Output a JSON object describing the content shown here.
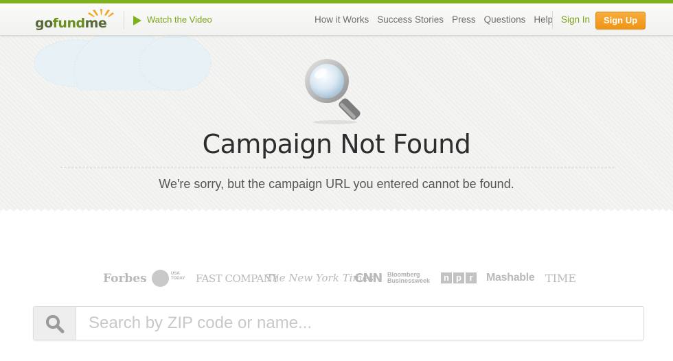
{
  "colors": {
    "accent_green": "#7fb21a",
    "link_green": "#7ba21a",
    "signup_orange": "#f0a028",
    "title_text": "#2d2d2d"
  },
  "header": {
    "logo_alt": "gofundme",
    "logo_go": "go",
    "logo_fund": "fund",
    "logo_me": "me",
    "watch_video_label": "Watch the Video",
    "nav": [
      "How it Works",
      "Success Stories",
      "Press",
      "Questions",
      "Help"
    ],
    "signin_label": "Sign In",
    "signup_label": "Sign Up"
  },
  "hero": {
    "icon": "magnifier-icon",
    "title": "Campaign Not Found",
    "subtitle": "We're sorry, but the campaign URL you entered cannot be found."
  },
  "press_logos": {
    "forbes": "Forbes",
    "usa_today_line1": "USA",
    "usa_today_line2": "TODAY",
    "fast_company": "FAST COMPANY",
    "nyt": "The New York Times",
    "cnn": "CNN",
    "bloomberg_line1": "Bloomberg",
    "bloomberg_line2": "Businessweek",
    "npr": [
      "n",
      "p",
      "r"
    ],
    "mashable": "Mashable",
    "time": "TIME"
  },
  "search": {
    "icon": "search-icon",
    "placeholder": "Search by ZIP code or name..."
  }
}
